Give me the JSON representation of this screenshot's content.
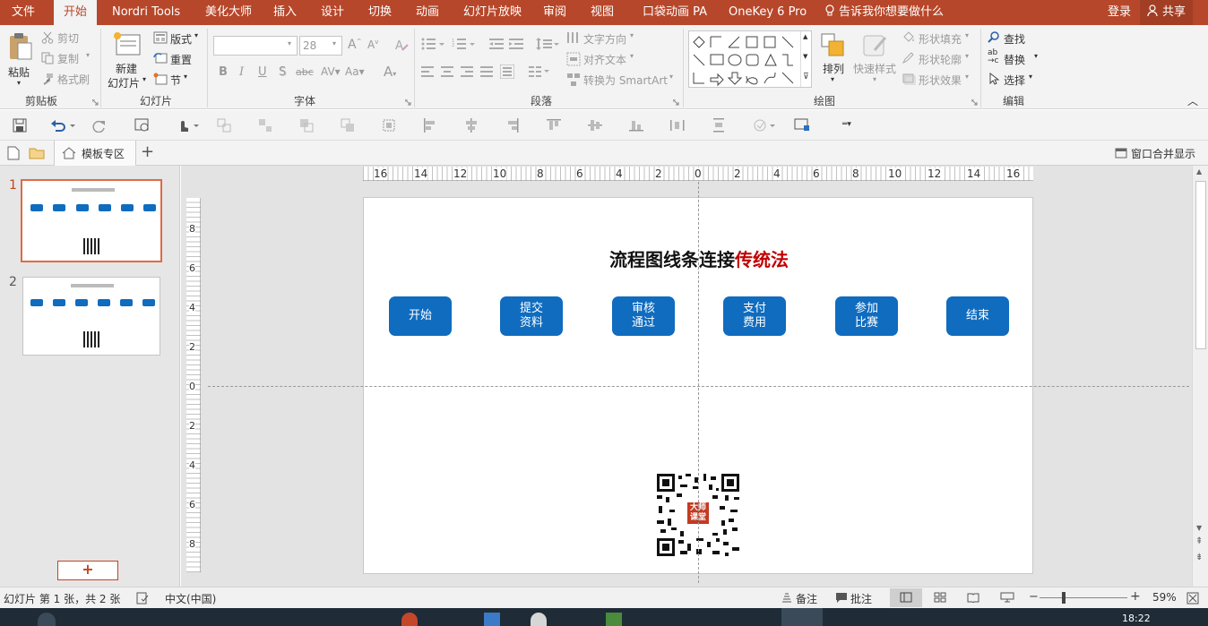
{
  "menu_tabs": [
    "文件",
    "开始",
    "Nordri Tools",
    "美化大师",
    "插入",
    "设计",
    "切换",
    "动画",
    "幻灯片放映",
    "审阅",
    "视图",
    "口袋动画 PA",
    "OneKey 6 Pro"
  ],
  "tell_me": "告诉我你想要做什么",
  "login": "登录",
  "share": "共享",
  "ribbon": {
    "clipboard": {
      "paste": "粘贴",
      "cut": "剪切",
      "copy": "复制",
      "format_painter": "格式刷",
      "label": "剪贴板"
    },
    "slides": {
      "new_slide_1": "新建",
      "new_slide_2": "幻灯片",
      "layout": "版式",
      "reset": "重置",
      "section": "节",
      "label": "幻灯片"
    },
    "font": {
      "font_name": "",
      "font_size": "28",
      "label": "字体"
    },
    "paragraph": {
      "text_direction": "文字方向",
      "align_text": "对齐文本",
      "smartart": "转换为 SmartArt",
      "label": "段落"
    },
    "drawing": {
      "arrange": "排列",
      "quick_styles": "快速样式",
      "shape_fill": "形状填充",
      "shape_outline": "形状轮廓",
      "shape_effects": "形状效果",
      "label": "绘图"
    },
    "editing": {
      "find": "查找",
      "replace": "替换",
      "select": "选择",
      "label": "编辑"
    }
  },
  "docbar": {
    "template_zone": "模板专区",
    "window_merge": "窗口合并显示"
  },
  "ruler_h": [
    "16",
    "14",
    "12",
    "10",
    "8",
    "6",
    "4",
    "2",
    "0",
    "2",
    "4",
    "6",
    "8",
    "10",
    "12",
    "14",
    "16"
  ],
  "ruler_v": [
    "8",
    "6",
    "4",
    "2",
    "0",
    "2",
    "4",
    "6",
    "8"
  ],
  "thumbnails": [
    {
      "number": "1"
    },
    {
      "number": "2"
    }
  ],
  "add_slide": "+",
  "slide": {
    "title_black": "流程图线条连接",
    "title_red": "传统法",
    "nodes": [
      "开始",
      "提交\n资料",
      "审核\n通过",
      "支付\n费用",
      "参加\n比赛",
      "结束"
    ],
    "qr_badge": "大师\n课堂"
  },
  "status": {
    "slide_info": "幻灯片 第 1 张，共 2 张",
    "language": "中文(中国)",
    "notes": "备注",
    "comments": "批注",
    "zoom": "59%"
  },
  "taskbar": {
    "clock": "18:22"
  },
  "colors": {
    "accent": "#b7472a",
    "node": "#0f6cbf",
    "title_red": "#c00000"
  }
}
